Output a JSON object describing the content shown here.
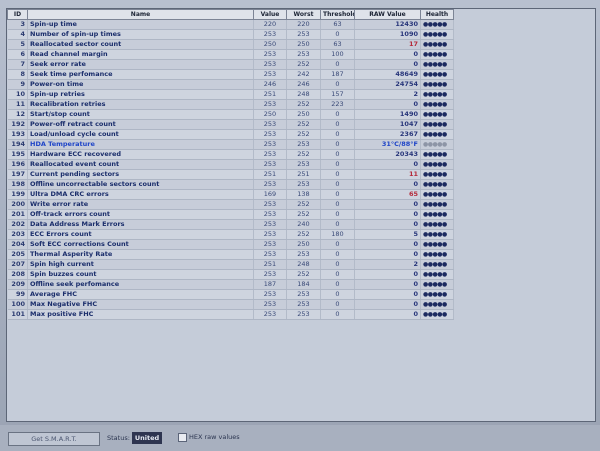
{
  "table": {
    "headers": {
      "id": "ID",
      "name": "Name",
      "value": "Value",
      "worst": "Worst",
      "threshold": "Threshold",
      "raw": "RAW Value",
      "health": "Health"
    },
    "rows": [
      {
        "id": "3",
        "name": "Spin-up time",
        "value": "220",
        "worst": "220",
        "threshold": "63",
        "raw": "12430",
        "health": "●●●●●"
      },
      {
        "id": "4",
        "name": "Number of spin-up times",
        "value": "253",
        "worst": "253",
        "threshold": "0",
        "raw": "1090",
        "health": "●●●●●"
      },
      {
        "id": "5",
        "name": "Reallocated sector count",
        "value": "250",
        "worst": "250",
        "threshold": "63",
        "raw": "17",
        "health": "●●●●●",
        "raw_style": "red"
      },
      {
        "id": "6",
        "name": "Read channel margin",
        "value": "253",
        "worst": "253",
        "threshold": "100",
        "raw": "0",
        "health": "●●●●●"
      },
      {
        "id": "7",
        "name": "Seek error rate",
        "value": "253",
        "worst": "252",
        "threshold": "0",
        "raw": "0",
        "health": "●●●●●"
      },
      {
        "id": "8",
        "name": "Seek time perfomance",
        "value": "253",
        "worst": "242",
        "threshold": "187",
        "raw": "48649",
        "health": "●●●●●"
      },
      {
        "id": "9",
        "name": "Power-on time",
        "value": "246",
        "worst": "246",
        "threshold": "0",
        "raw": "24754",
        "health": "●●●●●"
      },
      {
        "id": "10",
        "name": "Spin-up retries",
        "value": "251",
        "worst": "248",
        "threshold": "157",
        "raw": "2",
        "health": "●●●●●"
      },
      {
        "id": "11",
        "name": "Recalibration retries",
        "value": "253",
        "worst": "252",
        "threshold": "223",
        "raw": "0",
        "health": "●●●●●"
      },
      {
        "id": "12",
        "name": "Start/stop count",
        "value": "250",
        "worst": "250",
        "threshold": "0",
        "raw": "1490",
        "health": "●●●●●"
      },
      {
        "id": "192",
        "name": "Power-off retract count",
        "value": "253",
        "worst": "252",
        "threshold": "0",
        "raw": "1047",
        "health": "●●●●●"
      },
      {
        "id": "193",
        "name": "Load/unload cycle count",
        "value": "253",
        "worst": "252",
        "threshold": "0",
        "raw": "2367",
        "health": "●●●●●"
      },
      {
        "id": "194",
        "name": "HDA Temperature",
        "value": "253",
        "worst": "253",
        "threshold": "0",
        "raw": "31°C/88°F",
        "health": "●●●●●",
        "raw_style": "blue",
        "health_style": "dim",
        "temp": true
      },
      {
        "id": "195",
        "name": "Hardware ECC recovered",
        "value": "253",
        "worst": "252",
        "threshold": "0",
        "raw": "20343",
        "health": "●●●●●"
      },
      {
        "id": "196",
        "name": "Reallocated event count",
        "value": "253",
        "worst": "253",
        "threshold": "0",
        "raw": "0",
        "health": "●●●●●"
      },
      {
        "id": "197",
        "name": "Current pending sectors",
        "value": "251",
        "worst": "251",
        "threshold": "0",
        "raw": "11",
        "health": "●●●●●",
        "raw_style": "red"
      },
      {
        "id": "198",
        "name": "Offline uncorrectable sectors count",
        "value": "253",
        "worst": "253",
        "threshold": "0",
        "raw": "0",
        "health": "●●●●●"
      },
      {
        "id": "199",
        "name": "Ultra DMA CRC errors",
        "value": "169",
        "worst": "138",
        "threshold": "0",
        "raw": "65",
        "health": "●●●●●",
        "raw_style": "red"
      },
      {
        "id": "200",
        "name": "Write error rate",
        "value": "253",
        "worst": "252",
        "threshold": "0",
        "raw": "0",
        "health": "●●●●●"
      },
      {
        "id": "201",
        "name": "Off-track errors count",
        "value": "253",
        "worst": "252",
        "threshold": "0",
        "raw": "0",
        "health": "●●●●●"
      },
      {
        "id": "202",
        "name": "Data Address Mark Errors",
        "value": "253",
        "worst": "240",
        "threshold": "0",
        "raw": "0",
        "health": "●●●●●"
      },
      {
        "id": "203",
        "name": "ECC Errors count",
        "value": "253",
        "worst": "252",
        "threshold": "180",
        "raw": "5",
        "health": "●●●●●"
      },
      {
        "id": "204",
        "name": "Soft ECC corrections Count",
        "value": "253",
        "worst": "250",
        "threshold": "0",
        "raw": "0",
        "health": "●●●●●"
      },
      {
        "id": "205",
        "name": "Thermal Asperity Rate",
        "value": "253",
        "worst": "253",
        "threshold": "0",
        "raw": "0",
        "health": "●●●●●"
      },
      {
        "id": "207",
        "name": "Spin high current",
        "value": "251",
        "worst": "248",
        "threshold": "0",
        "raw": "2",
        "health": "●●●●●"
      },
      {
        "id": "208",
        "name": "Spin buzzes count",
        "value": "253",
        "worst": "252",
        "threshold": "0",
        "raw": "0",
        "health": "●●●●●"
      },
      {
        "id": "209",
        "name": "Offline seek perfomance",
        "value": "187",
        "worst": "184",
        "threshold": "0",
        "raw": "0",
        "health": "●●●●●"
      },
      {
        "id": "99",
        "name": "Average FHC",
        "value": "253",
        "worst": "253",
        "threshold": "0",
        "raw": "0",
        "health": "●●●●●"
      },
      {
        "id": "100",
        "name": "Max Negative FHC",
        "value": "253",
        "worst": "253",
        "threshold": "0",
        "raw": "0",
        "health": "●●●●●"
      },
      {
        "id": "101",
        "name": "Max positive FHC",
        "value": "253",
        "worst": "253",
        "threshold": "0",
        "raw": "0",
        "health": "●●●●●"
      }
    ]
  },
  "bottom": {
    "get_smart_label": "Get S.M.A.R.T.",
    "status_label": "Status:",
    "status_value": "United",
    "hex_label": "HEX raw values"
  }
}
